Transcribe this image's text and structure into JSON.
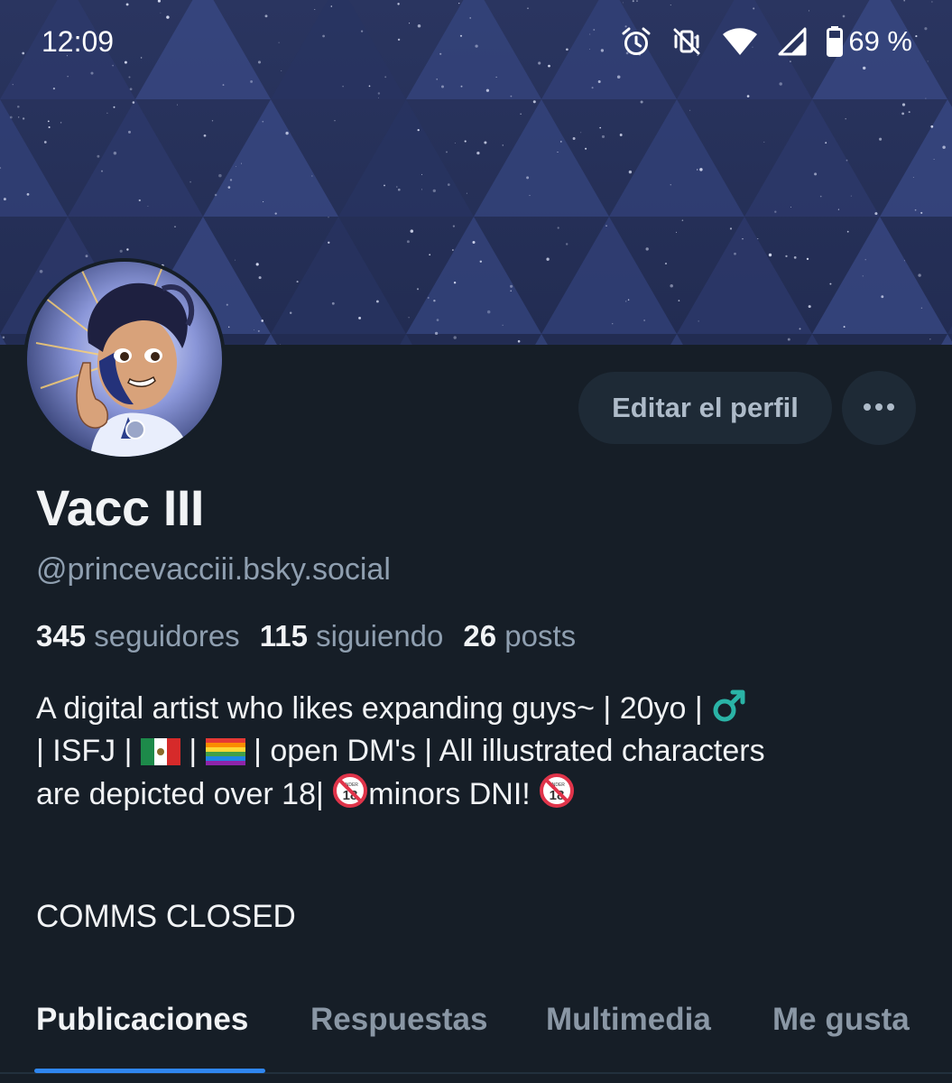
{
  "status_bar": {
    "time": "12:09",
    "battery_percent": "69 %",
    "icons": [
      "alarm-icon",
      "vibrate-off-icon",
      "wifi-icon",
      "signal-icon",
      "battery-icon"
    ]
  },
  "profile": {
    "display_name": "Vacc III",
    "handle": "@princevacciii.bsky.social",
    "edit_label": "Editar el perfil",
    "more_icon": "more-horizontal-icon"
  },
  "stats": {
    "followers_count": "345",
    "followers_label": "seguidores",
    "following_count": "115",
    "following_label": "siguiendo",
    "posts_count": "26",
    "posts_label": "posts"
  },
  "bio": {
    "line1_text": "A digital artist who likes expanding guys~ | 20yo | ",
    "line2_a": "| ISFJ | ",
    "line2_b": " | ",
    "line2_c": " | open DM's | All illustrated characters",
    "line3_a": "are depicted over  18| ",
    "line3_b": "minors DNI! ",
    "emoji": [
      "male-sign",
      "mexico-flag",
      "rainbow-flag",
      "no-one-under-18",
      "no-one-under-18"
    ],
    "under_text": "UNDER",
    "eighteen": "18",
    "comms": "COMMS CLOSED"
  },
  "tabs": [
    {
      "label": "Publicaciones",
      "active": true
    },
    {
      "label": "Respuestas",
      "active": false
    },
    {
      "label": "Multimedia",
      "active": false
    },
    {
      "label": "Me gusta",
      "active": false
    }
  ],
  "colors": {
    "background": "#161e27",
    "accent": "#2f86f0",
    "muted_text": "#8f9fb0",
    "button_bg": "#1e2a36"
  }
}
